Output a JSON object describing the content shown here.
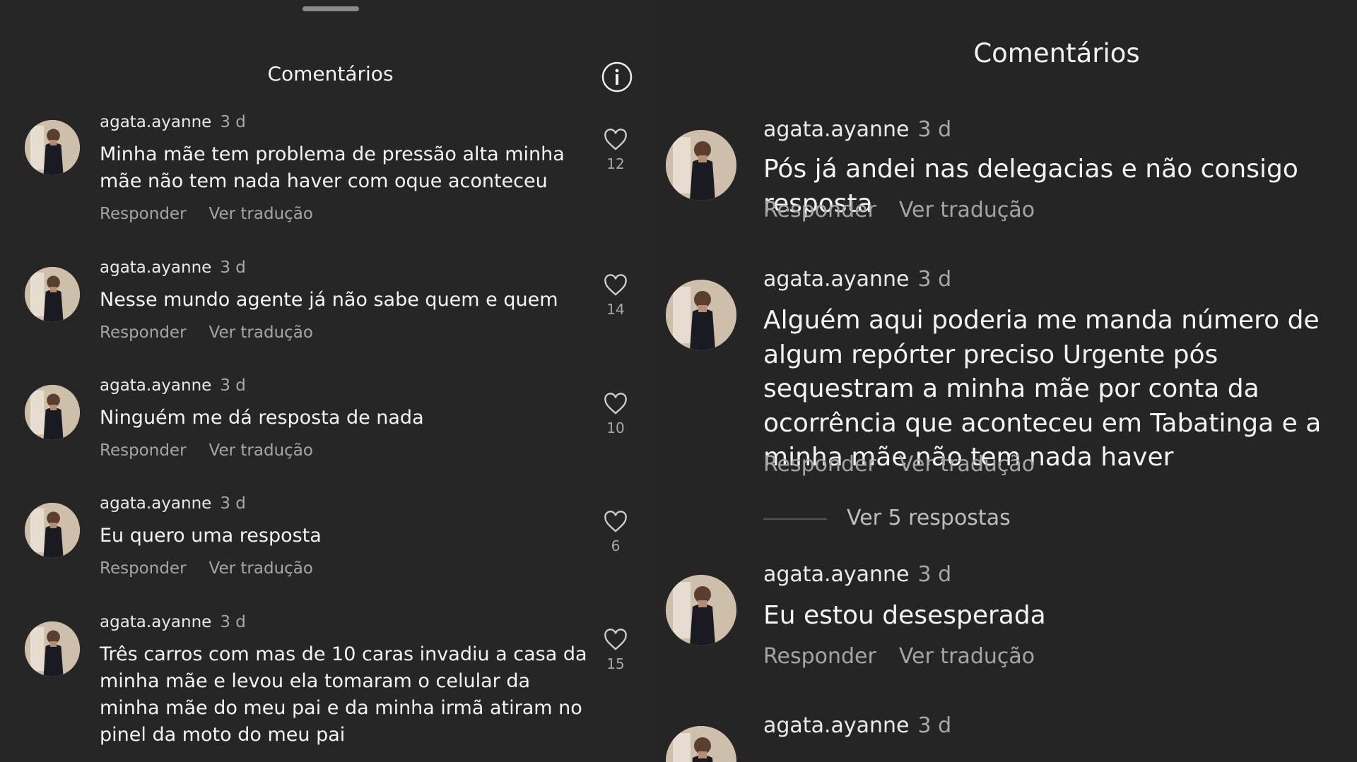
{
  "left_panel": {
    "title": "Comentários",
    "info_icon": "info-icon",
    "comments": [
      {
        "user": "agata.ayanne",
        "time": "3 d",
        "text": "Minha mãe tem problema de pressão alta minha mãe não tem nada haver com oque aconteceu",
        "reply": "Responder",
        "translate": "Ver tradução",
        "likes": "12"
      },
      {
        "user": "agata.ayanne",
        "time": "3 d",
        "text": "Nesse mundo agente já não sabe quem e quem",
        "reply": "Responder",
        "translate": "Ver tradução",
        "likes": "14"
      },
      {
        "user": "agata.ayanne",
        "time": "3 d",
        "text": "Ninguém me dá resposta de nada",
        "reply": "Responder",
        "translate": "Ver tradução",
        "likes": "10"
      },
      {
        "user": "agata.ayanne",
        "time": "3 d",
        "text": "Eu quero uma resposta",
        "reply": "Responder",
        "translate": "Ver tradução",
        "likes": "6"
      },
      {
        "user": "agata.ayanne",
        "time": "3 d",
        "text": "Três carros com mas de 10 caras invadiu a casa da minha mãe e levou ela tomaram o celular da minha mãe do meu pai e da minha irmã atiram no pinel da moto do meu pai",
        "likes": "15"
      }
    ]
  },
  "right_panel": {
    "title": "Comentários",
    "comments": [
      {
        "user": "agata.ayanne",
        "time": "3 d",
        "text": "Pós já andei nas delegacias e não consigo resposta",
        "reply": "Responder",
        "translate": "Ver tradução"
      },
      {
        "user": "agata.ayanne",
        "time": "3 d",
        "text": "Alguém aqui poderia me manda número de algum repórter preciso Urgente pós sequestram a minha mãe por conta da ocorrência que aconteceu em Tabatinga e a minha mãe não tem nada haver",
        "reply": "Responder",
        "translate": "Ver tradução",
        "view_replies": "Ver 5 respostas"
      },
      {
        "user": "agata.ayanne",
        "time": "3 d",
        "text": "Eu estou desesperada",
        "reply": "Responder",
        "translate": "Ver tradução"
      },
      {
        "user": "agata.ayanne",
        "time": "3 d"
      }
    ]
  },
  "colors": {
    "background": "#262626",
    "text": "#f4f4f4",
    "muted": "#a5a5a5"
  }
}
